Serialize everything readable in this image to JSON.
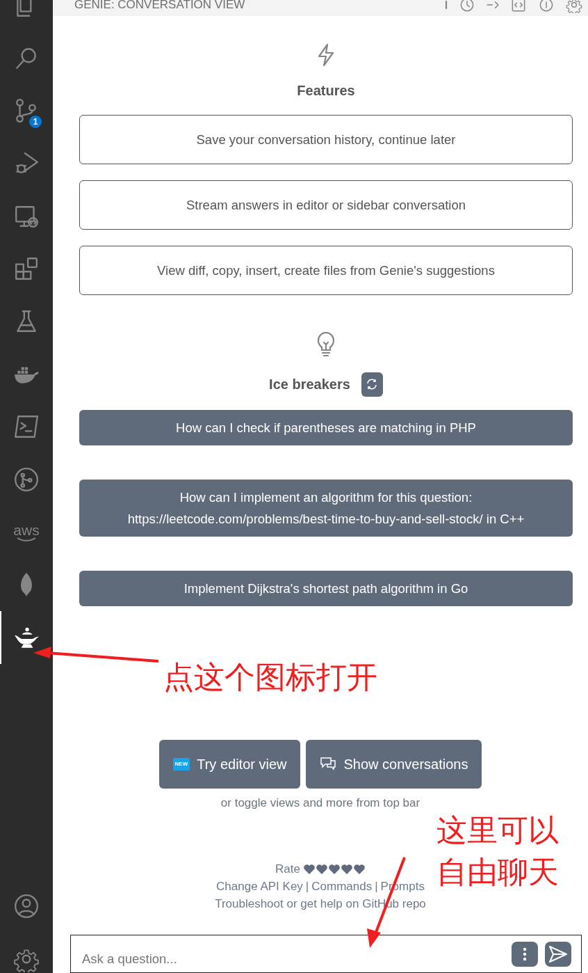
{
  "activity_bar": {
    "items": [
      {
        "kind": "files",
        "selected": false
      },
      {
        "kind": "search",
        "selected": false
      },
      {
        "kind": "source-control",
        "selected": false,
        "badge": "1"
      },
      {
        "kind": "run-debug",
        "selected": false
      },
      {
        "kind": "remote",
        "selected": false
      },
      {
        "kind": "extensions",
        "selected": false
      },
      {
        "kind": "flask",
        "selected": false
      },
      {
        "kind": "whale",
        "selected": false
      },
      {
        "kind": "terminal",
        "selected": false
      },
      {
        "kind": "git-graph",
        "selected": false
      },
      {
        "kind": "aws",
        "selected": false,
        "label": "aws"
      },
      {
        "kind": "leaf",
        "selected": false
      },
      {
        "kind": "lamp",
        "selected": true
      }
    ],
    "bottom_items": [
      {
        "kind": "account"
      },
      {
        "kind": "gear"
      }
    ]
  },
  "panel": {
    "title": "GENIE: CONVERSATION VIEW"
  },
  "features": {
    "title": "Features",
    "items": [
      "Save your conversation history, continue later",
      "Stream answers in editor or sidebar conversation",
      "View diff, copy, insert, create files from Genie's suggestions"
    ]
  },
  "ice_breakers": {
    "title": "Ice breakers",
    "items": [
      "How can I check if parentheses are matching in PHP",
      "How can I implement an algorithm for this question: https://leetcode.com/problems/best-time-to-buy-and-sell-stock/ in C++",
      "Implement Dijkstra's shortest path algorithm in Go"
    ]
  },
  "actions": [
    {
      "kind": "editor",
      "badge": "NEW",
      "label": "Try editor view"
    },
    {
      "kind": "conversations",
      "label": "Show conversations"
    }
  ],
  "actions_hint": "or toggle views and more from top bar",
  "footer": {
    "rate": "Rate",
    "links": [
      "Change API Key",
      "Commands",
      "Prompts"
    ],
    "separator": "|",
    "help": "Troubleshoot or get help on GitHub repo"
  },
  "input": {
    "placeholder": "Ask a question..."
  },
  "annotations": [
    {
      "lines": [
        "点这个图标打开"
      ]
    },
    {
      "lines": [
        "这里可以",
        "自由聊天"
      ]
    }
  ]
}
